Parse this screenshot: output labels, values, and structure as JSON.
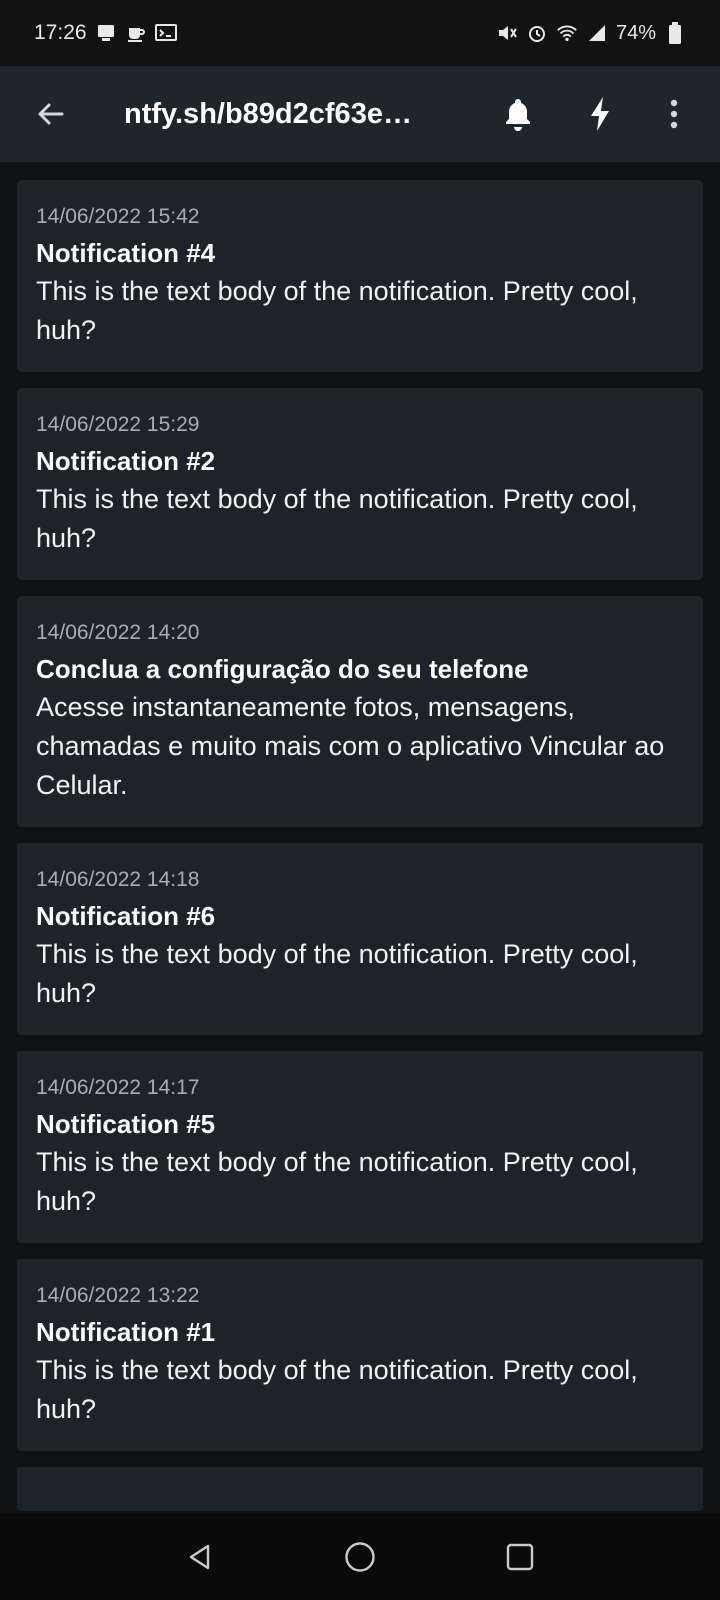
{
  "statusbar": {
    "time": "17:26",
    "battery": "74%",
    "icons": [
      "notification-icon",
      "cup-icon",
      "terminal-icon",
      "mute-icon",
      "alarm-icon",
      "wifi-icon",
      "signal-icon",
      "battery-icon"
    ]
  },
  "appbar": {
    "title": "ntfy.sh/b89d2cf63e…",
    "back_icon": "arrow-left-icon",
    "actions": [
      "bell-icon",
      "bolt-icon",
      "more-vert-icon"
    ]
  },
  "notifications": [
    {
      "date": "14/06/2022 15:42",
      "title": "Notification #4",
      "body": "This is the text body of the notification. Pretty cool, huh?"
    },
    {
      "date": "14/06/2022 15:29",
      "title": "Notification #2",
      "body": "This is the text body of the notification. Pretty cool, huh?"
    },
    {
      "date": "14/06/2022 14:20",
      "title": "Conclua a configuração do seu telefone",
      "body": "Acesse instantaneamente fotos, mensagens, chamadas e muito mais com o aplicativo Vincular ao Celular."
    },
    {
      "date": "14/06/2022 14:18",
      "title": "Notification #6",
      "body": "This is the text body of the notification. Pretty cool, huh?"
    },
    {
      "date": "14/06/2022 14:17",
      "title": "Notification #5",
      "body": "This is the text body of the notification. Pretty cool, huh?"
    },
    {
      "date": "14/06/2022 13:22",
      "title": "Notification #1",
      "body": "This is the text body of the notification. Pretty cool, huh?"
    }
  ],
  "navbar": {
    "buttons": [
      "back-triangle-icon",
      "home-circle-icon",
      "recents-square-icon"
    ]
  },
  "colors": {
    "background": "#0f1113",
    "appbar": "#1f2529",
    "card": "#1e2327",
    "date_text": "#a9adb1"
  }
}
